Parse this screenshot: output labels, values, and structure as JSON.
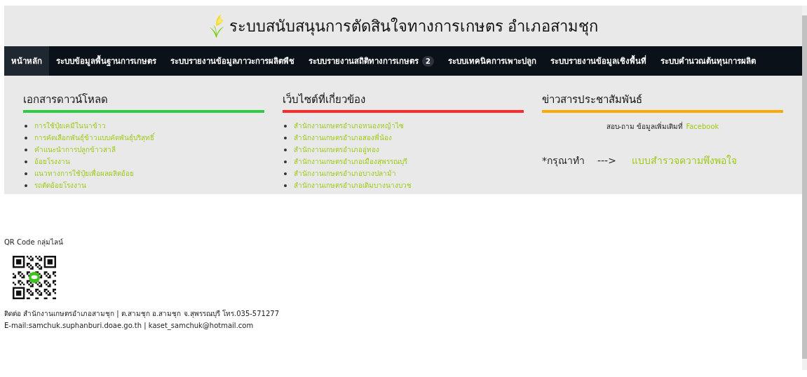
{
  "header": {
    "title": "ระบบสนับสนุนการตัดสินใจทางการเกษตร อำเภอสามชุก"
  },
  "nav": [
    {
      "label": "หน้าหลัก",
      "selected": true
    },
    {
      "label": "ระบบข้อมูลพื้นฐานการเกษตร",
      "selected": false
    },
    {
      "label": "ระบบรายงานข้อมูลภาวะการผลิตพืช",
      "selected": false
    },
    {
      "label": "ระบบรายงานสถิติทางการเกษตร",
      "selected": false,
      "badge": "2"
    },
    {
      "label": "ระบบเทคนิคการเพาะปลูก",
      "selected": false
    },
    {
      "label": "ระบบรายงานข้อมูลเชิงพื้นที่",
      "selected": false
    },
    {
      "label": "ระบบคำนวณต้นทุนการผลิต",
      "selected": false
    }
  ],
  "sections": [
    {
      "kind": "links",
      "title": "เอกสารดาวน์โหลด",
      "color": "#2ecc40",
      "links": [
        "การใช้ปุ๋ยเคมีในนาข้าว",
        "การคัดเลือกพันธุ์ข้าวแบบคัดพันธุ์บริสุทธิ์",
        "คำแนะนำการปลูกข้าวสาลี",
        "อ้อยโรงงาน",
        "แนวทางการใช้ปุ๋ยเพื่อผลผลิตอ้อย",
        "รถตัดอ้อยโรงงาน"
      ]
    },
    {
      "kind": "links",
      "title": "เว็บไซต์ที่เกี่ยวข้อง",
      "color": "#ff2a2a",
      "links": [
        "สำนักงานเกษตรอำเภอหนองหญ้าไซ",
        "สำนักงานเกษตรอำเภอสองพี่น้อง",
        "สำนักงานเกษตรอำเภออู่ทอง",
        "สำนักงานเกษตรอำเภอเมืองสุพรรณบุรี",
        "สำนักงานเกษตรอำเภอบางปลาม้า",
        "สำนักงานเกษตรอำเภอเดิมบางนางบวช"
      ]
    },
    {
      "kind": "news",
      "title": "ข่าวสารประชาสัมพันธ์",
      "color": "#ffaa00",
      "contact": {
        "text": "สอบ-ถาม ข้อมูลเพิ่มเติมที่",
        "link": "Facebook"
      },
      "survey": {
        "prompt": "*กรุณาทำ",
        "arrow": "--->",
        "link": "แบบสำรวจความพึงพอใจ"
      }
    }
  ],
  "footer": {
    "qr_label": "QR Code กลุ่มไลน์",
    "contact": "ติดต่อ สำนักงานเกษตรอำเภอสามชุก | ต.สามชุก อ.สามชุก จ.สุพรรณบุรี โทร.035-571277",
    "email": "E-mail:samchuk.suphanburi.doae.go.th | kaset_samchuk@hotmail.com"
  }
}
